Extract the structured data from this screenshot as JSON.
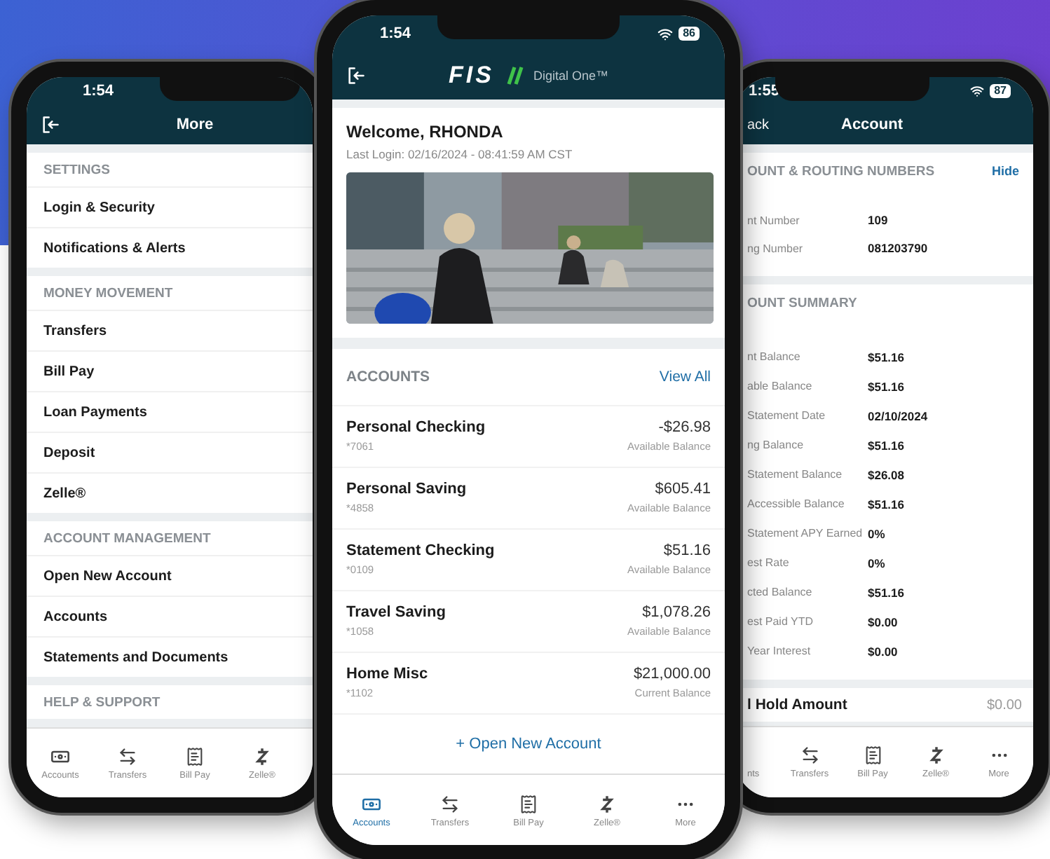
{
  "more_screen": {
    "status_time": "1:54",
    "title": "More",
    "sections": [
      {
        "heading": "SETTINGS",
        "items": [
          "Login & Security",
          "Notifications & Alerts"
        ]
      },
      {
        "heading": "MONEY MOVEMENT",
        "items": [
          "Transfers",
          "Bill Pay",
          "Loan Payments",
          "Deposit",
          "Zelle®"
        ]
      },
      {
        "heading": "ACCOUNT MANAGEMENT",
        "items": [
          "Open New Account",
          "Accounts",
          "Statements and Documents"
        ]
      },
      {
        "heading": "HELP & SUPPORT"
      }
    ],
    "tab_bar": [
      {
        "kind": "accounts",
        "label": "Accounts",
        "selected": false
      },
      {
        "kind": "transfers",
        "label": "Transfers",
        "selected": false
      },
      {
        "kind": "bill_pay",
        "label": "Bill Pay",
        "selected": false
      },
      {
        "kind": "zelle",
        "label": "Zelle®",
        "selected": false
      }
    ]
  },
  "home_screen": {
    "status_time": "1:54",
    "battery": "86",
    "logo": {
      "brand": "FIS",
      "product": "Digital One™"
    },
    "welcome": "Welcome, RHONDA",
    "last_login": "Last Login: 02/16/2024 - 08:41:59 AM CST",
    "accounts": {
      "title": "ACCOUNTS",
      "link": "View All",
      "rows": [
        {
          "name": "Personal Checking",
          "number": "*7061",
          "amount": "-$26.98",
          "balance_label": "Available Balance"
        },
        {
          "name": "Personal Saving",
          "number": "*4858",
          "amount": "$605.41",
          "balance_label": "Available Balance"
        },
        {
          "name": "Statement Checking",
          "number": "*0109",
          "amount": "$51.16",
          "balance_label": "Available Balance"
        },
        {
          "name": "Travel Saving",
          "number": "*1058",
          "amount": "$1,078.26",
          "balance_label": "Available Balance"
        },
        {
          "name": "Home Misc",
          "number": "*1102",
          "amount": "$21,000.00",
          "balance_label": "Current Balance"
        }
      ]
    },
    "open_account": "+ Open New Account",
    "tab_bar": [
      {
        "kind": "accounts",
        "label": "Accounts",
        "selected": true
      },
      {
        "kind": "transfers",
        "label": "Transfers",
        "selected": false
      },
      {
        "kind": "bill_pay",
        "label": "Bill Pay",
        "selected": false
      },
      {
        "kind": "zelle",
        "label": "Zelle®",
        "selected": false
      },
      {
        "kind": "more",
        "label": "More",
        "selected": false
      }
    ]
  },
  "account_screen": {
    "status_time": "1:55",
    "battery": "87",
    "back": "ack",
    "title": "Account",
    "routing": {
      "title": "OUNT & ROUTING NUMBERS",
      "action": "Hide",
      "rows": [
        {
          "label": "nt Number",
          "value": "109"
        },
        {
          "label": "ng Number",
          "value": "081203790"
        }
      ]
    },
    "summary": {
      "title": "OUNT SUMMARY",
      "rows": [
        {
          "label": "nt Balance",
          "value": "$51.16"
        },
        {
          "label": "able Balance",
          "value": "$51.16"
        },
        {
          "label": "Statement Date",
          "value": "02/10/2024"
        },
        {
          "label": "ng Balance",
          "value": "$51.16"
        },
        {
          "label": "Statement Balance",
          "value": "$26.08"
        },
        {
          "label": "Accessible Balance",
          "value": "$51.16"
        },
        {
          "label": "Statement APY Earned",
          "value": "0%"
        },
        {
          "label": "est Rate",
          "value": "0%"
        },
        {
          "label": "cted Balance",
          "value": "$51.16"
        },
        {
          "label": "est Paid YTD",
          "value": "$0.00"
        },
        {
          "label": "Year Interest",
          "value": "$0.00"
        }
      ]
    },
    "hold": {
      "label": "l Hold Amount",
      "value": "$0.00"
    },
    "tab_bar": [
      {
        "label": "nts",
        "selected": false
      },
      {
        "kind": "transfers",
        "label": "Transfers",
        "selected": false
      },
      {
        "kind": "bill_pay",
        "label": "Bill Pay",
        "selected": false
      },
      {
        "kind": "zelle",
        "label": "Zelle®",
        "selected": false
      },
      {
        "kind": "more",
        "label": "More",
        "selected": false
      }
    ]
  }
}
